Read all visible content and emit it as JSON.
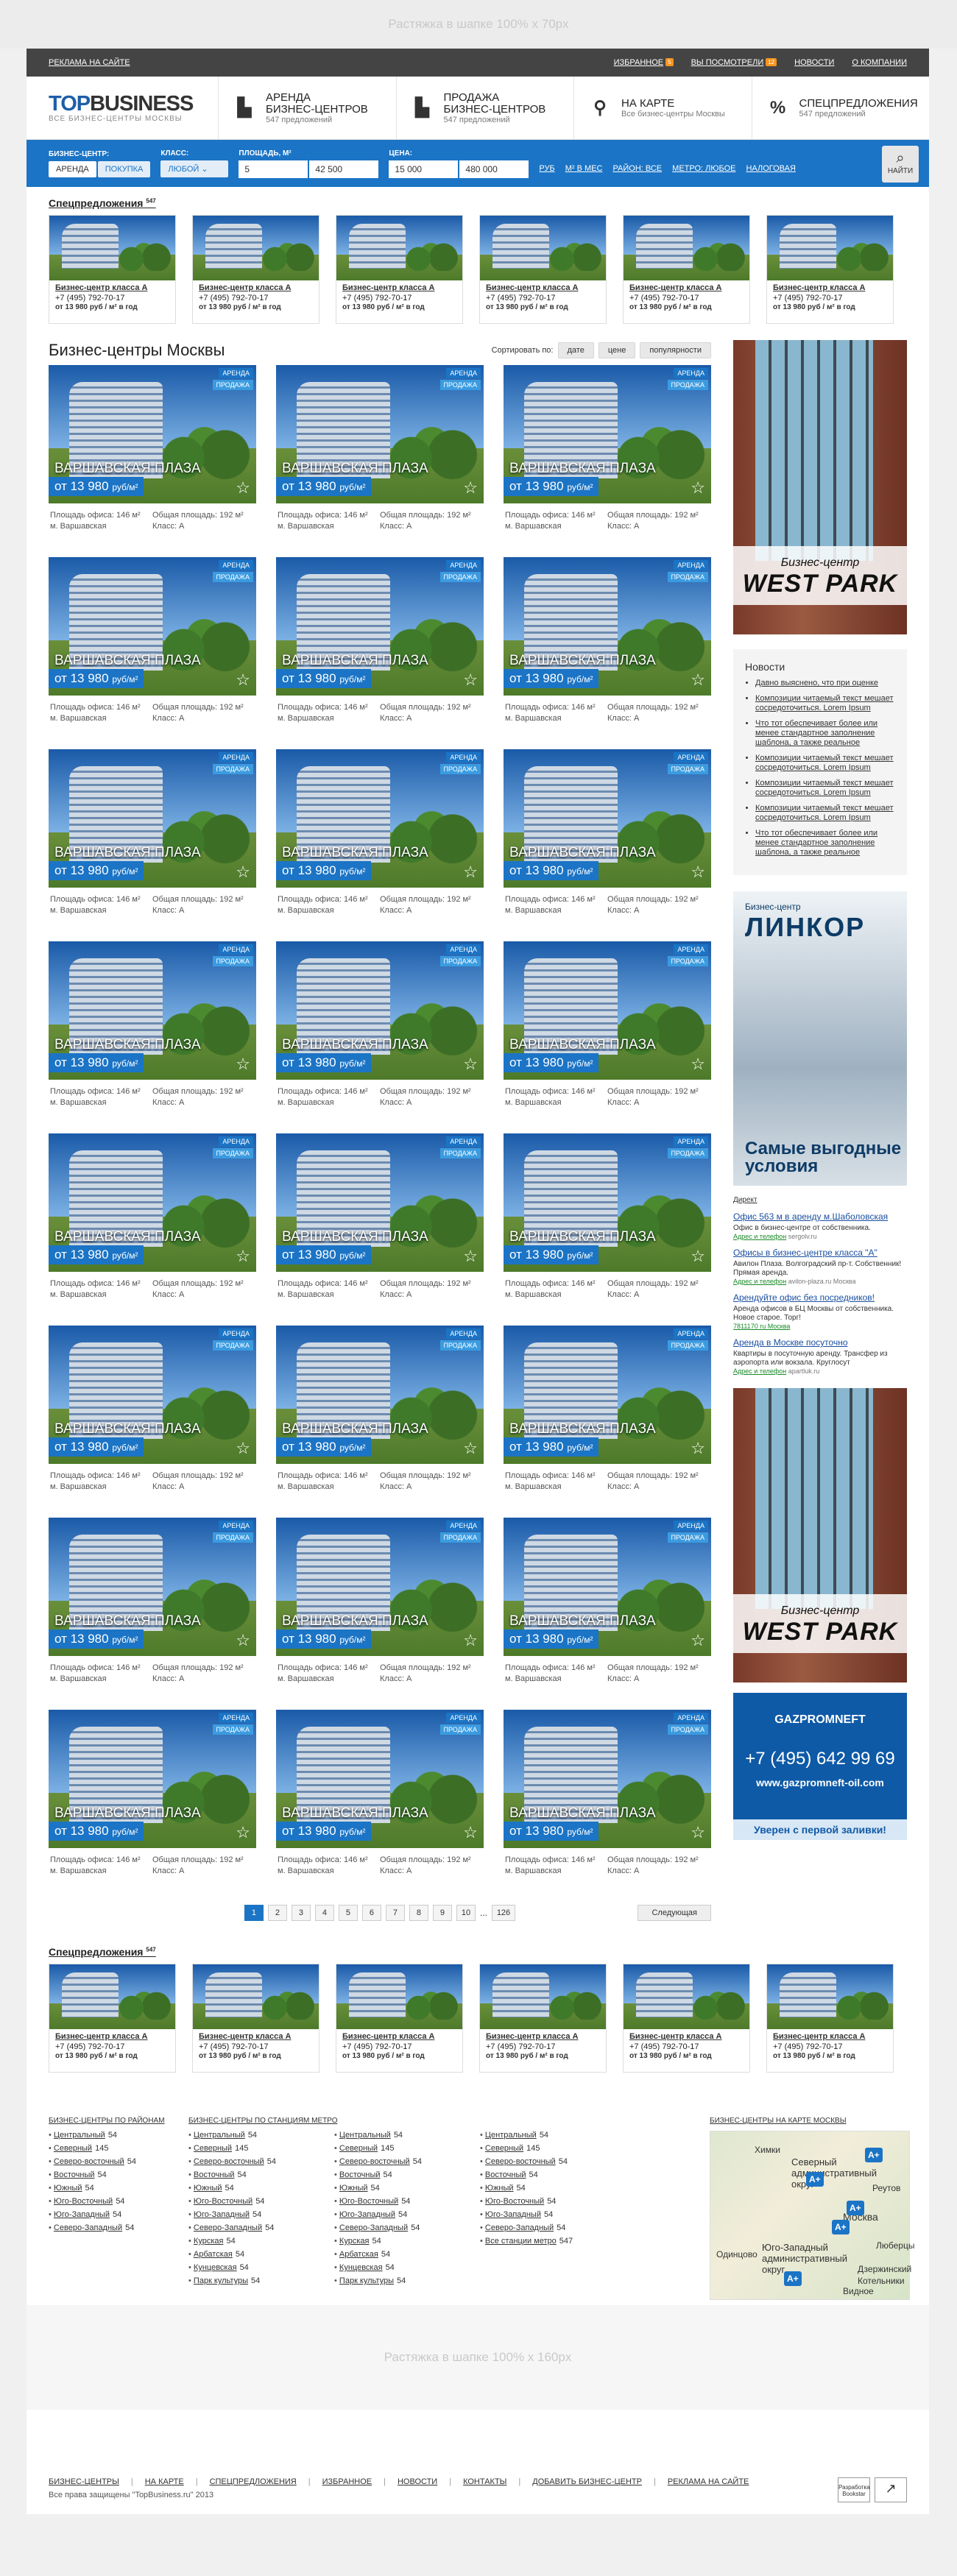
{
  "banner_top": "Растяжка в шапке 100% x 70px",
  "banner_bottom": "Растяжка в шапке 100% x 160px",
  "topbar": {
    "ad_link": "РЕКЛАМА НА САЙТЕ",
    "favorites": "ИЗБРАННОЕ",
    "favorites_count": "5",
    "viewed": "ВЫ ПОСМОТРЕЛИ",
    "viewed_count": "12",
    "news": "НОВОСТИ",
    "about": "О КОМПАНИИ"
  },
  "logo": {
    "top": "TOP",
    "business": "BUSINESS",
    "tagline": "ВСЕ БИЗНЕС-ЦЕНТРЫ МОСКВЫ"
  },
  "hnav": [
    {
      "title1": "АРЕНДА",
      "title2": "БИЗНЕС-ЦЕНТРОВ",
      "sub": "547 предложений",
      "icon": "building-icon"
    },
    {
      "title1": "ПРОДАЖА",
      "title2": "БИЗНЕС-ЦЕНТРОВ",
      "sub": "547 предложений",
      "icon": "building-icon"
    },
    {
      "title1": "НА КАРТЕ",
      "title2": "",
      "sub": "Все бизнес-центры Москвы",
      "icon": "map-pin-icon"
    },
    {
      "title1": "СПЕЦПРЕДЛОЖЕНИЯ",
      "title2": "",
      "sub": "547 предложений",
      "icon": "percent-icon"
    }
  ],
  "filter": {
    "bc_label": "БИЗНЕС-ЦЕНТР:",
    "rent": "АРЕНДА",
    "buy": "ПОКУПКА",
    "class_label": "КЛАСС:",
    "class_value": "ЛЮБОЙ",
    "area_label": "ПЛОЩАДЬ, М²",
    "area_from": "5",
    "area_to": "42 500",
    "price_label": "ЦЕНА:",
    "price_from": "15 000",
    "price_to": "480 000",
    "currency": "руб",
    "unit": "м² в мес",
    "district": "РАЙОН: ВСЕ",
    "metro": "МЕТРО: ЛЮБОЕ",
    "tax": "НАЛОГОВАЯ",
    "search": "НАЙТИ"
  },
  "spec": {
    "title": "Спецпредложения",
    "count": "547",
    "cards": [
      {
        "name": "Бизнес-центр класса А",
        "phone": "+7 (495) 792-70-17",
        "price": "от 13 980 руб / м² в год"
      },
      {
        "name": "Бизнес-центр класса А",
        "phone": "+7 (495) 792-70-17",
        "price": "от 13 980 руб / м² в год"
      },
      {
        "name": "Бизнес-центр класса А",
        "phone": "+7 (495) 792-70-17",
        "price": "от 13 980 руб / м² в год"
      },
      {
        "name": "Бизнес-центр класса А",
        "phone": "+7 (495) 792-70-17",
        "price": "от 13 980 руб / м² в год"
      },
      {
        "name": "Бизнес-центр класса А",
        "phone": "+7 (495) 792-70-17",
        "price": "от 13 980 руб / м² в год"
      },
      {
        "name": "Бизнес-центр класса А",
        "phone": "+7 (495) 792-70-17",
        "price": "от 13 980 руб / м² в год"
      }
    ]
  },
  "main": {
    "title": "Бизнес-центры Москвы",
    "sort_label": "Сортировать по:",
    "sort": [
      "дате",
      "цене",
      "популярности"
    ]
  },
  "listing": {
    "tag_rent": "АРЕНДА",
    "tag_sale": "ПРОДАЖА",
    "name": "ВАРШАВСКАЯ ПЛАЗА",
    "price": "от 13 980",
    "price_unit": "руб/м²",
    "area_office": "Площадь офиса: 146 м²",
    "area_total": "Общая площадь: 192 м²",
    "metro": "м. Варшавская",
    "class": "Класс: А"
  },
  "pager": {
    "pages": [
      "1",
      "2",
      "3",
      "4",
      "5",
      "6",
      "7",
      "8",
      "9",
      "10",
      "...",
      "126"
    ],
    "next": "Следующая"
  },
  "side": {
    "ad1": {
      "line1": "Бизнес-центр",
      "line2": "WEST PARK"
    },
    "news_title": "Новости",
    "news": [
      "Давно выяснено, что при оценке",
      "Композиции читаемый текст мешает сосредоточиться. Lorem Ipsum",
      "Что тот обеспечивает более или менее стандартное заполнение шаблона, а также реальное",
      "Композиции читаемый текст мешает сосредоточиться. Lorem Ipsum",
      "Композиции читаемый текст мешает сосредоточиться. Lorem Ipsum",
      "Композиции читаемый текст мешает сосредоточиться. Lorem Ipsum",
      "Что тот обеспечивает более или менее стандартное заполнение шаблона, а также реальное"
    ],
    "ad2": {
      "line1": "Бизнес-центр",
      "line2": "ЛИНКОР",
      "foot": "Самые выгодные условия"
    },
    "direct_label": "Директ",
    "direct": [
      {
        "t": "Офис 563 м в аренду м.Шаболовская",
        "d": "Офис в бизнес-центре от собственника.",
        "u": "Адрес и телефон",
        "h": "sergolv.ru"
      },
      {
        "t": "Офисы в бизнес-центре класса \"А\"",
        "d": "Авилон Плаза. Волгоградский пр-т. Собственник! Прямая аренда.",
        "u": "Адрес и телефон",
        "h": "avilon-plaza.ru Москва"
      },
      {
        "t": "Арендуйте офис без посредников!",
        "d": "Аренда офисов в БЦ Москвы от собственника. Новое старое. Торг!",
        "u": "7811170 ru Москва",
        "h": ""
      },
      {
        "t": "Аренда в Москве посуточно",
        "d": "Квартиры в посуточную аренду. Трансфер из аэропорта или вокзала. Круглосут",
        "u": "Адрес и телефон",
        "h": "apartluk.ru"
      }
    ],
    "ad3": {
      "line1": "Бизнес-центр",
      "line2": "WEST PARK"
    },
    "ad4": {
      "logo": "GAZPROMNEFT",
      "phone": "+7 (495) 642 99 69",
      "url": "www.gazpromneft-oil.com",
      "slogan": "Уверен с первой заливки!"
    }
  },
  "links": {
    "districts_title": "БИЗНЕС-ЦЕНТРЫ ПО РАЙОНАМ",
    "districts": [
      [
        "Центральный",
        "54"
      ],
      [
        "Северный",
        "145"
      ],
      [
        "Северо-восточный",
        "54"
      ],
      [
        "Восточный",
        "54"
      ],
      [
        "Южный",
        "54"
      ],
      [
        "Юго-Восточный",
        "54"
      ],
      [
        "Юго-Западный",
        "54"
      ],
      [
        "Северо-Западный",
        "54"
      ]
    ],
    "metro_title": "БИЗНЕС-ЦЕНТРЫ ПО СТАНЦИЯМ МЕТРО",
    "metro_cols": [
      [
        [
          "Центральный",
          "54"
        ],
        [
          "Северный",
          "145"
        ],
        [
          "Северо-восточный",
          "54"
        ],
        [
          "Восточный",
          "54"
        ],
        [
          "Южный",
          "54"
        ],
        [
          "Юго-Восточный",
          "54"
        ],
        [
          "Юго-Западный",
          "54"
        ],
        [
          "Северо-Западный",
          "54"
        ],
        [
          "Курская",
          "54"
        ],
        [
          "Арбатская",
          "54"
        ],
        [
          "Кунцевская",
          "54"
        ],
        [
          "Парк культуры",
          "54"
        ]
      ],
      [
        [
          "Центральный",
          "54"
        ],
        [
          "Северный",
          "145"
        ],
        [
          "Северо-восточный",
          "54"
        ],
        [
          "Восточный",
          "54"
        ],
        [
          "Южный",
          "54"
        ],
        [
          "Юго-Восточный",
          "54"
        ],
        [
          "Юго-Западный",
          "54"
        ],
        [
          "Северо-Западный",
          "54"
        ],
        [
          "Курская",
          "54"
        ],
        [
          "Арбатская",
          "54"
        ],
        [
          "Кунцевская",
          "54"
        ],
        [
          "Парк культуры",
          "54"
        ]
      ],
      [
        [
          "Центральный",
          "54"
        ],
        [
          "Северный",
          "145"
        ],
        [
          "Северо-восточный",
          "54"
        ],
        [
          "Восточный",
          "54"
        ],
        [
          "Южный",
          "54"
        ],
        [
          "Юго-Восточный",
          "54"
        ],
        [
          "Юго-Западный",
          "54"
        ],
        [
          "Северо-Западный",
          "54"
        ],
        [
          "Все станции метро",
          "547"
        ]
      ]
    ],
    "map_title": "БИЗНЕС-ЦЕНТРЫ НА КАРТЕ МОСКВЫ",
    "map_labels": [
      "Северный административный округ",
      "Москва",
      "Юго-Западный административный округ",
      "Реутов",
      "Люберцы",
      "Видное",
      "Химки",
      "Одинцово",
      "Дзержинский",
      "Котельники"
    ]
  },
  "footer": {
    "nav": [
      "БИЗНЕС-ЦЕНТРЫ",
      "НА КАРТЕ",
      "СПЕЦПРЕДЛОЖЕНИЯ",
      "ИЗБРАННОЕ",
      "НОВОСТИ",
      "КОНТАКТЫ",
      "ДОБАВИТЬ БИЗНЕС-ЦЕНТР",
      "РЕКЛАМА НА САЙТЕ"
    ],
    "copy": "Все права защищены \"TopBusiness.ru\" 2013",
    "dev": "Разработка Bookstar"
  }
}
